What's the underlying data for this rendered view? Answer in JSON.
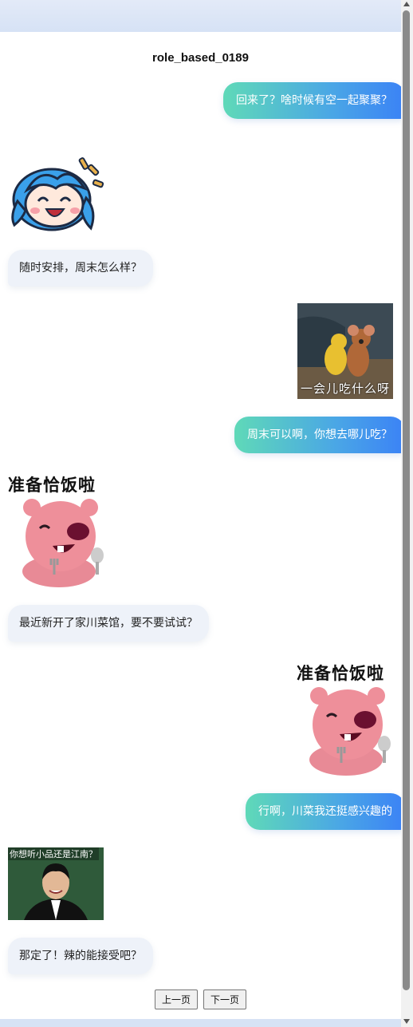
{
  "title": "role_based_0189",
  "messages": {
    "m1": "回来了？啥时候有空一起聚聚？",
    "m2": "随时安排，周末怎么样？",
    "m3": "周末可以啊，你想去哪儿吃？",
    "m4": "最近新开了家川菜馆，要不要试试？",
    "m5": "行啊，川菜我还挺感兴趣的",
    "m6": "那定了！辣的能接受吧？"
  },
  "stickers": {
    "jerry_caption": "一会儿吃什么呀",
    "loopy_caption": "准备恰饭啦",
    "photo_caption": "你想听小品还是江南？"
  },
  "pager": {
    "prev": "上一页",
    "next": "下一页"
  }
}
